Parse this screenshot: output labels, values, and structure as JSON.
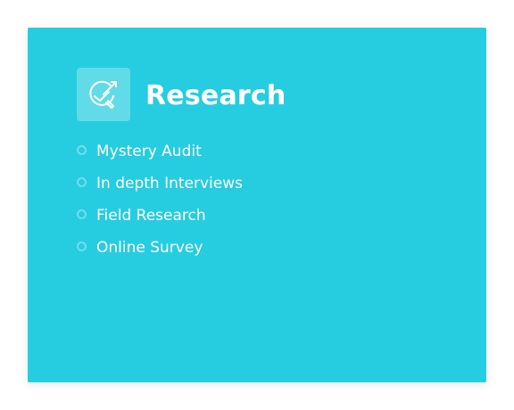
{
  "card": {
    "title": "Research",
    "icon": "research-target-icon",
    "items": [
      {
        "label": "Mystery Audit"
      },
      {
        "label": "In depth Interviews"
      },
      {
        "label": "Field Research"
      },
      {
        "label": "Online Survey"
      }
    ]
  },
  "colors": {
    "card_background": "#26cde0",
    "text": "#ffffff"
  }
}
